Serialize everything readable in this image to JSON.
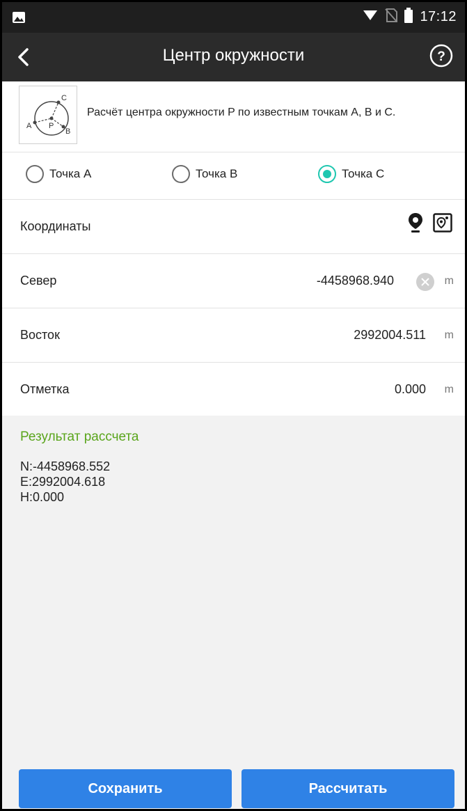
{
  "status_bar": {
    "time": "17:12"
  },
  "header": {
    "title": "Центр окружности"
  },
  "description": {
    "text": "Расчёт центра окружности P по известным точкам A, B и C.",
    "diagram_labels": {
      "a": "A",
      "b": "B",
      "c": "C",
      "p": "P"
    }
  },
  "points": [
    {
      "label": "Точка A",
      "checked": false
    },
    {
      "label": "Точка B",
      "checked": false
    },
    {
      "label": "Точка C",
      "checked": true
    }
  ],
  "coordinates": {
    "label": "Координаты",
    "fields": [
      {
        "label": "Север",
        "value": "-4458968.940",
        "unit": "m"
      },
      {
        "label": "Восток",
        "value": "2992004.511",
        "unit": "m"
      },
      {
        "label": "Отметка",
        "value": "0.000",
        "unit": "m"
      }
    ]
  },
  "result": {
    "title": "Результат рассчета",
    "lines": [
      "N:-4458968.552",
      "E:2992004.618",
      "H:0.000"
    ]
  },
  "buttons": {
    "save": "Сохранить",
    "calculate": "Рассчитать"
  },
  "colors": {
    "accent": "#1fc7b0",
    "button": "#2f82e6",
    "result_title": "#5aa51c",
    "appbar": "#2b2b2b"
  }
}
